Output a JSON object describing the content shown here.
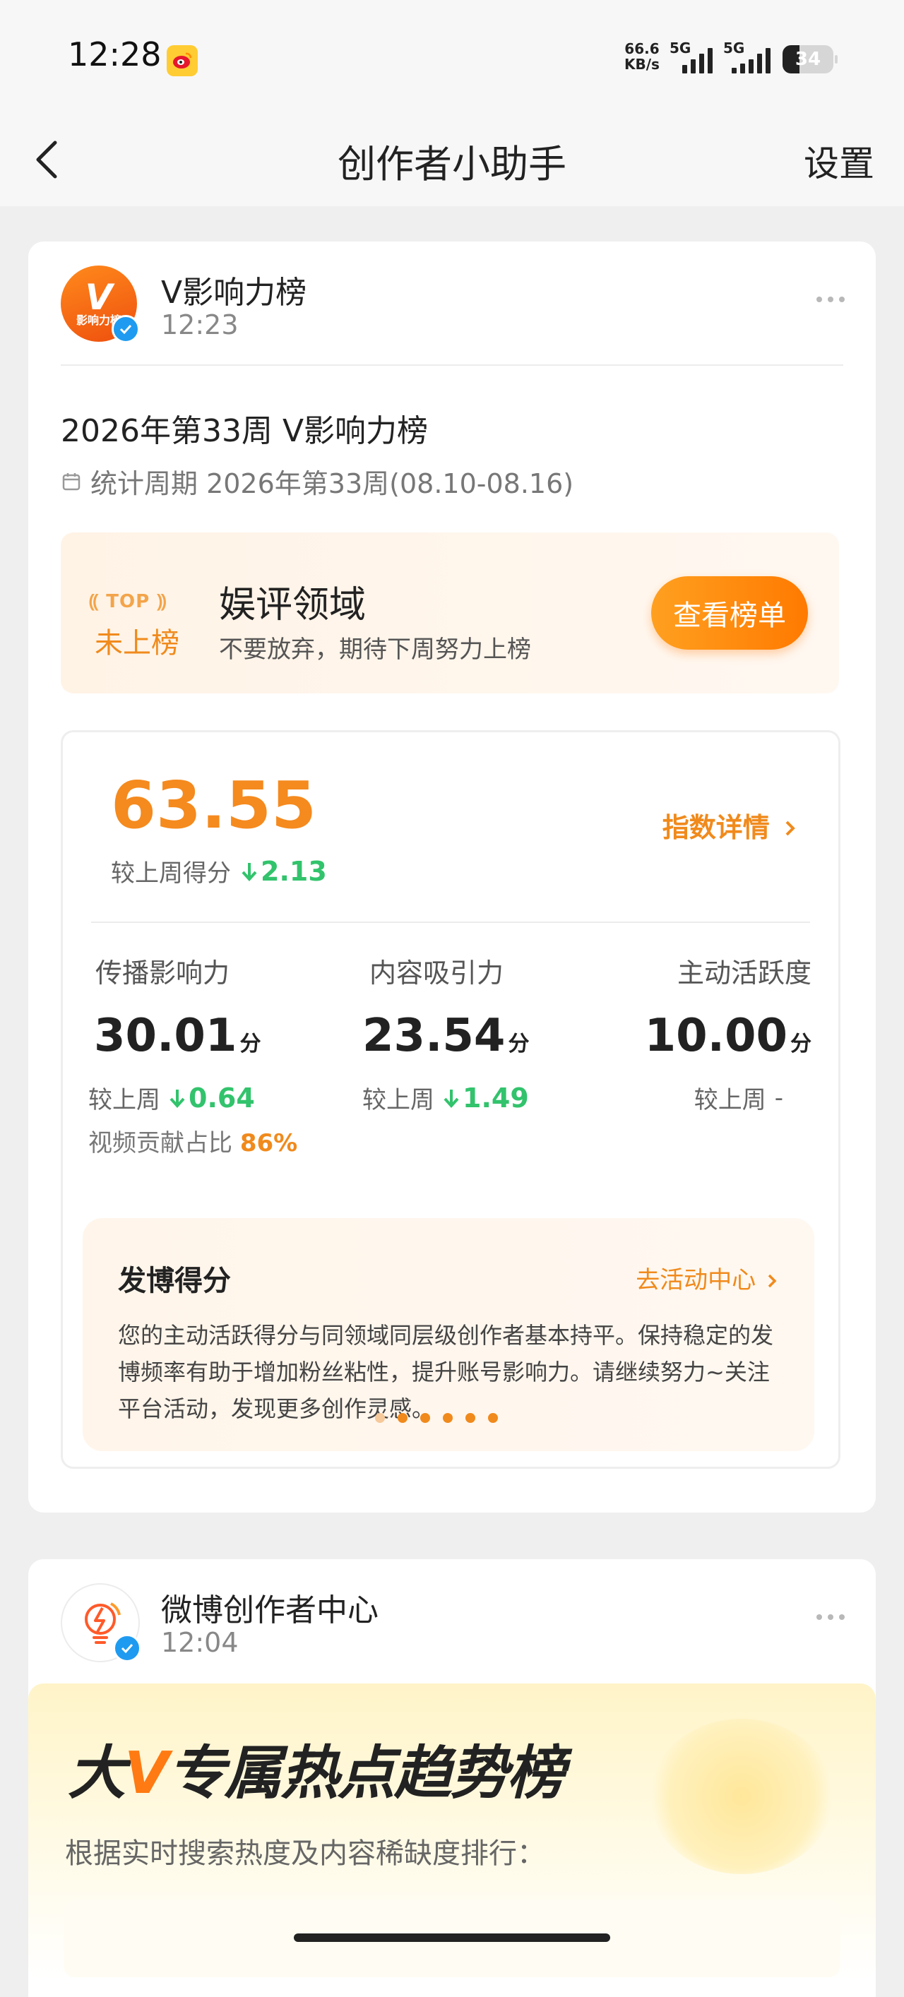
{
  "status_bar": {
    "time": "12:28",
    "net_speed_value": "66.6",
    "net_speed_unit": "KB/s",
    "signal1_label": "5G",
    "signal2_label": "5G",
    "battery": "34"
  },
  "nav": {
    "title": "创作者小助手",
    "settings_label": "设置"
  },
  "post1": {
    "account_name": "V影响力榜",
    "time": "12:23",
    "avatar_line1": "V",
    "avatar_line2": "影响力榜",
    "title": "2026年第33周 V影响力榜",
    "period": "统计周期 2026年第33周(08.10-08.16)",
    "rank": {
      "top_tag": "TOP",
      "status": "未上榜",
      "domain": "娱评领域",
      "subtitle": "不要放弃，期待下周努力上榜",
      "button": "查看榜单"
    },
    "score": {
      "value": "63.55",
      "compare_label": "较上周得分",
      "compare_value": "2.13",
      "detail_link": "指数详情"
    },
    "metrics": [
      {
        "label": "传播影响力",
        "value": "30.01",
        "unit": "分",
        "compare_label": "较上周",
        "compare_value": "0.64",
        "share_label": "视频贡献占比",
        "share_value": "86%"
      },
      {
        "label": "内容吸引力",
        "value": "23.54",
        "unit": "分",
        "compare_label": "较上周",
        "compare_value": "1.49"
      },
      {
        "label": "主动活跃度",
        "value": "10.00",
        "unit": "分",
        "compare_label": "较上周",
        "compare_value": "-"
      }
    ],
    "tip": {
      "title": "发博得分",
      "link": "去活动中心",
      "body": "您的主动活跃得分与同领域同层级创作者基本持平。保持稳定的发博频率有助于增加粉丝粘性，提升账号影响力。请继续努力~关注平台活动，发现更多创作灵感。"
    }
  },
  "post2": {
    "account_name": "微博创作者中心",
    "time": "12:04",
    "promo_title_prefix": "大",
    "promo_title_v": "V",
    "promo_title_rest": "专属热点趋势榜",
    "promo_desc": "根据实时搜索热度及内容稀缺度排行："
  },
  "colors": {
    "accent": "#f58a1e",
    "down": "#32c36c",
    "verified": "#1e9bf0"
  }
}
